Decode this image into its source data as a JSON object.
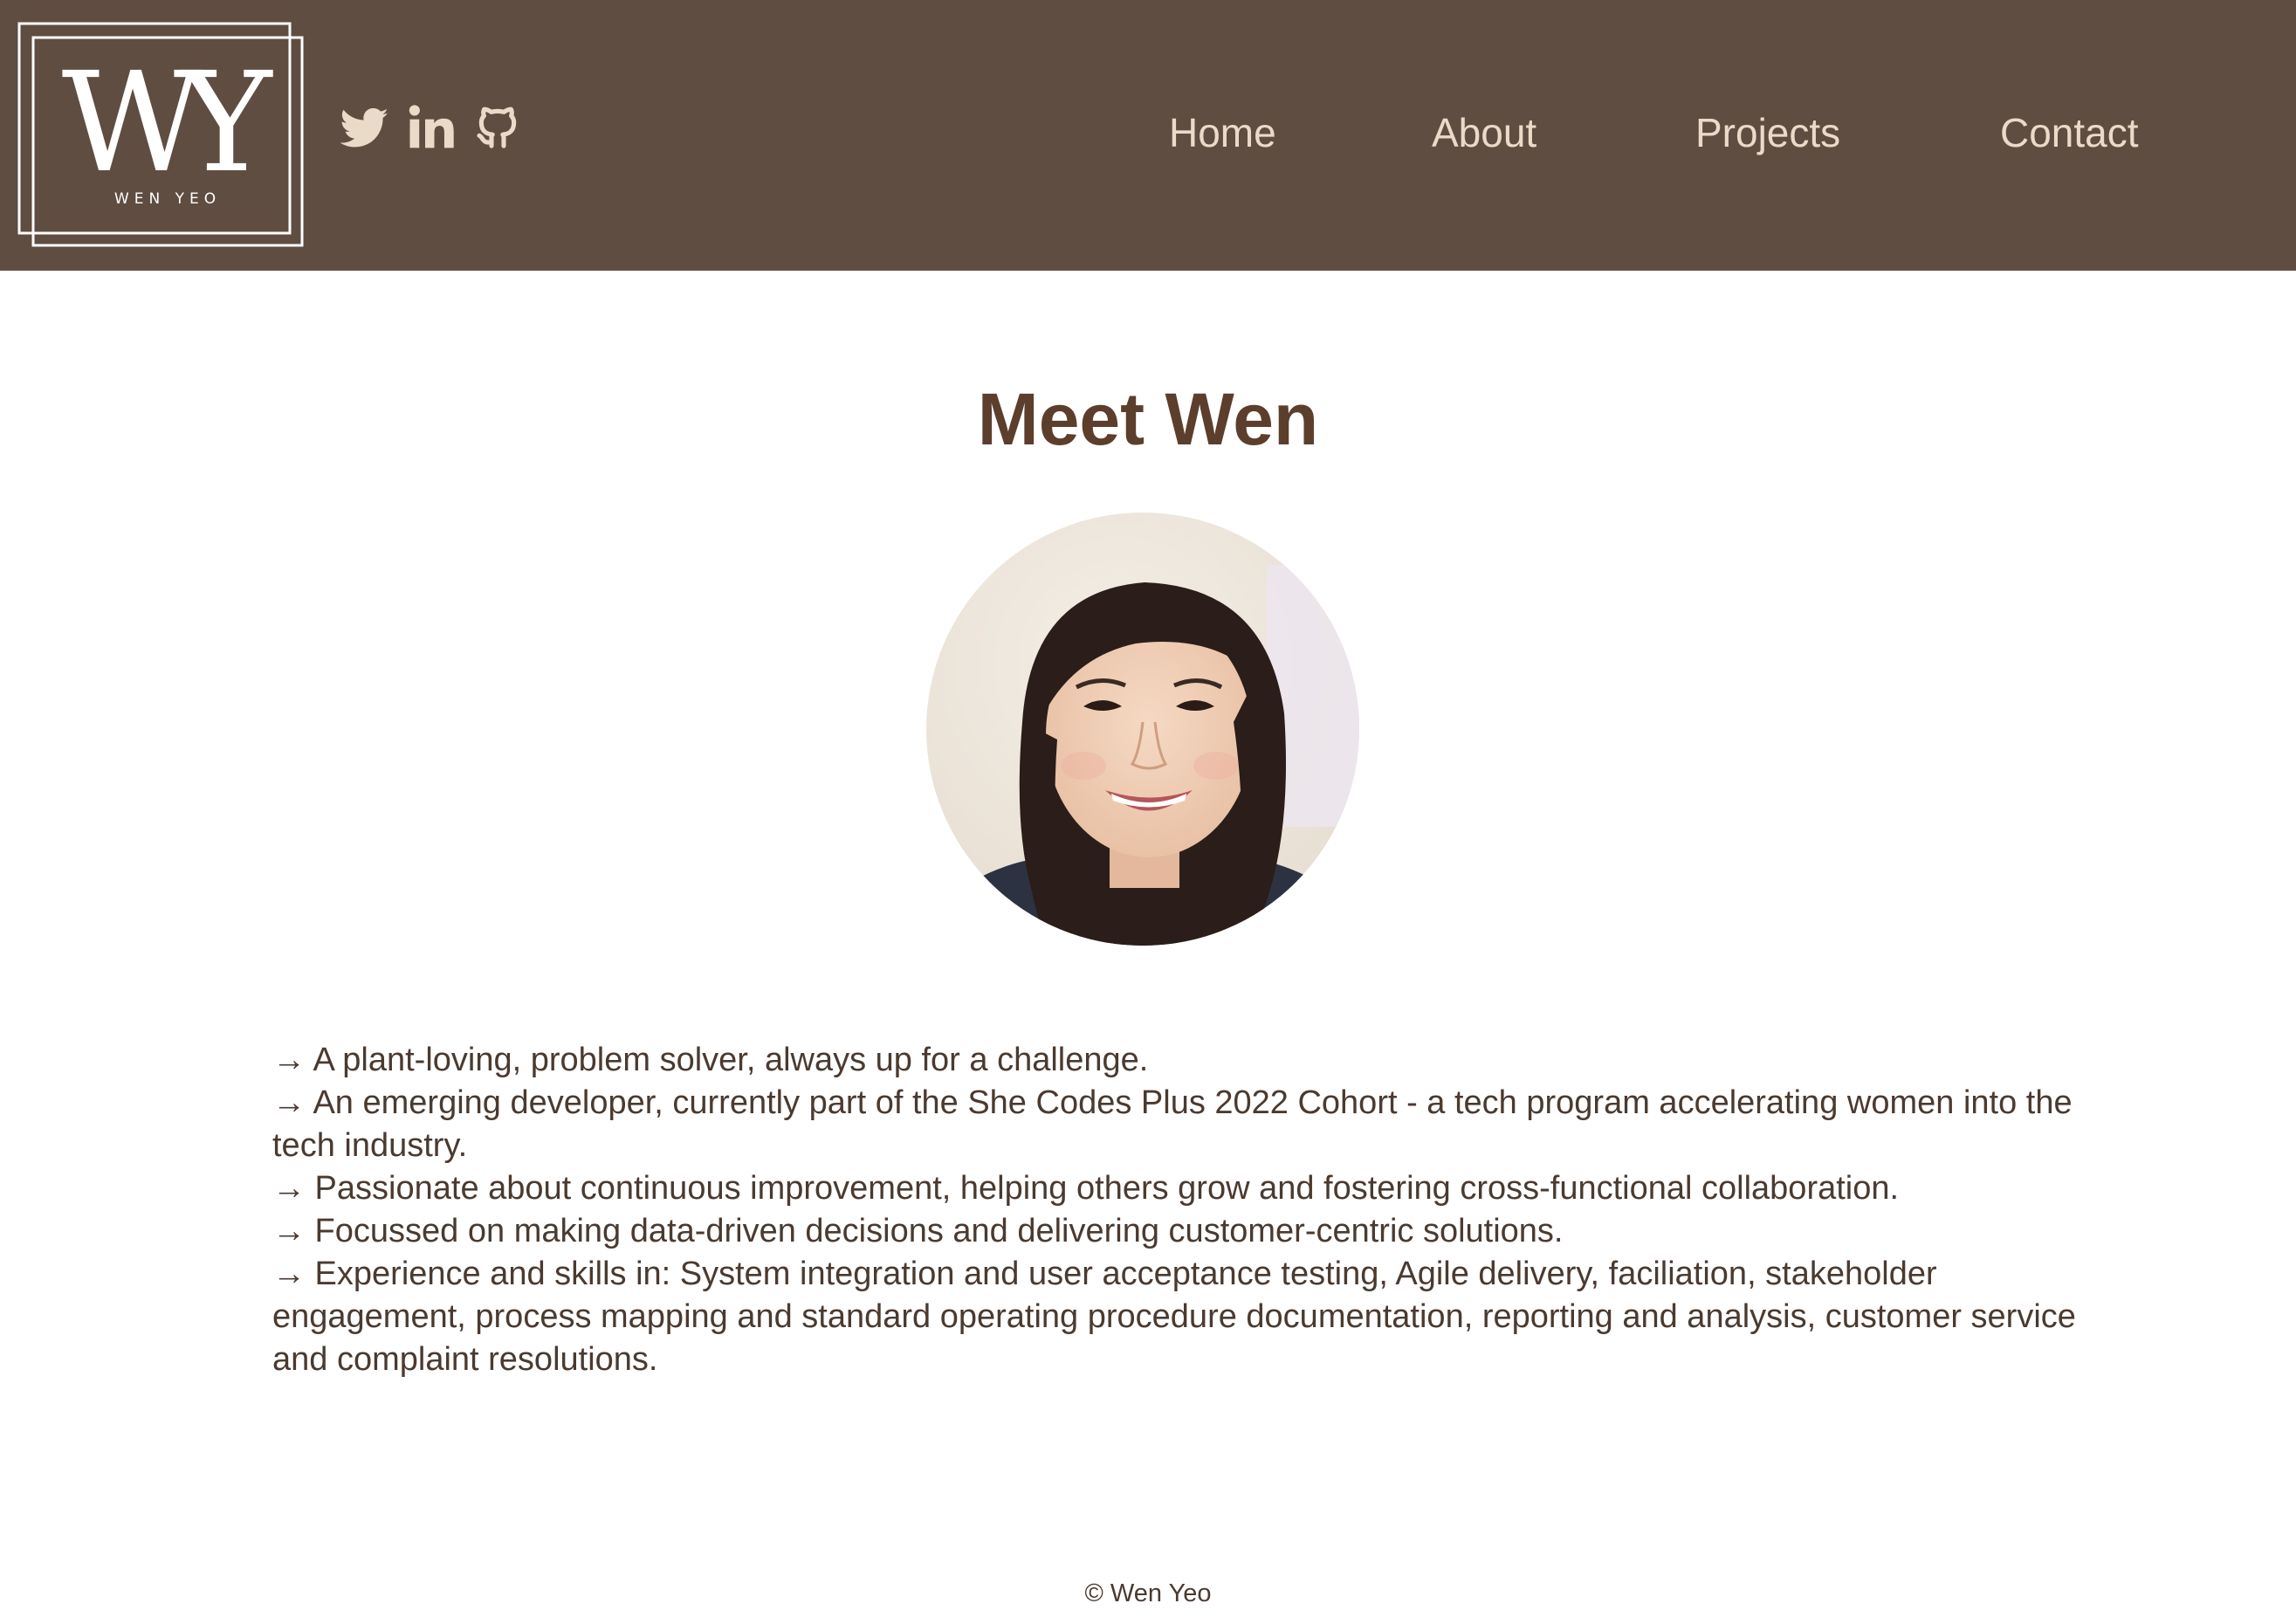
{
  "header": {
    "logo": {
      "monogram": "WY",
      "wordmark": "WEN YEO",
      "icon": "wen-yeo-logo"
    },
    "social": [
      {
        "name": "Twitter",
        "icon": "twitter-icon"
      },
      {
        "name": "LinkedIn",
        "icon": "linkedin-icon"
      },
      {
        "name": "GitHub",
        "icon": "github-icon"
      }
    ],
    "nav": [
      {
        "label": "Home"
      },
      {
        "label": "About"
      },
      {
        "label": "Projects"
      },
      {
        "label": "Contact"
      }
    ]
  },
  "main": {
    "title": "Meet Wen",
    "portrait_icon": "profile-photo",
    "bio": [
      "→ A plant-loving, problem solver, always up for a challenge.",
      "→ An emerging developer, currently part of the She Codes Plus 2022 Cohort - a tech program accelerating women into the tech industry.",
      "→ Passionate about continuous improvement, helping others grow and fostering cross-functional collaboration.",
      "→ Focussed on making data-driven decisions and delivering customer-centric solutions.",
      "→ Experience and skills in: System integration and user acceptance testing, Agile delivery, faciliation, stakeholder engagement, process mapping and standard operating procedure documentation, reporting and analysis, customer service and complaint resolutions."
    ]
  },
  "footer": {
    "copyright": "© Wen Yeo"
  },
  "colors": {
    "header_bg": "#5f4d42",
    "nav_text": "#eadbc8",
    "title": "#5c3e2c",
    "body_text": "#4a3a30",
    "page_bg": "#ffffff"
  }
}
